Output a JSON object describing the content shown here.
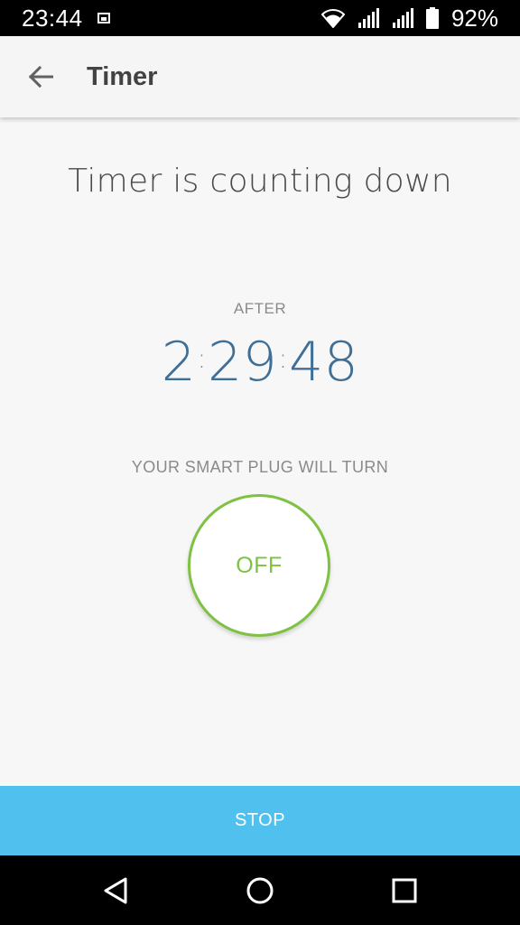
{
  "status_bar": {
    "time": "23:44",
    "battery_percent": "92%",
    "icons": [
      "image-notification-icon",
      "wifi-icon",
      "signal-icon",
      "signal-icon",
      "battery-icon"
    ]
  },
  "app_bar": {
    "title": "Timer",
    "back_icon": "arrow-back-icon"
  },
  "main": {
    "headline": "Timer is counting down",
    "after_label": "AFTER",
    "countdown": {
      "hours": "2",
      "minutes": "29",
      "seconds": "48",
      "separator": ":"
    },
    "turn_label": "YOUR SMART PLUG WILL TURN",
    "target_state": "OFF"
  },
  "actions": {
    "stop_label": "STOP"
  },
  "colors": {
    "accent_blue": "#50c0ee",
    "countdown_blue": "#3f6f97",
    "state_green": "#7dc242"
  },
  "nav_bar": {
    "icons": [
      "back-triangle-icon",
      "home-circle-icon",
      "recents-square-icon"
    ]
  }
}
